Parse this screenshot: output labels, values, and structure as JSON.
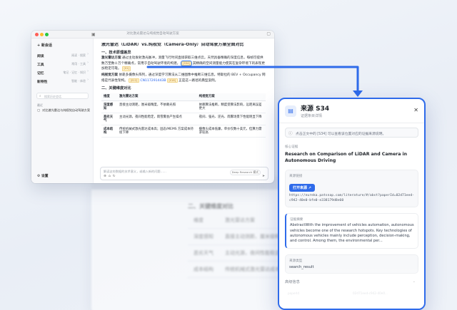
{
  "app": {
    "window_title": "对比激光雷达与纯视觉自动驾驶方案",
    "colors": {
      "accent": "#2f6bea",
      "ref_bg": "#fff3cd",
      "ref_text": "#b7791f"
    }
  },
  "sidebar": {
    "new_chat": "+ 新会话",
    "items": [
      {
        "label": "阅读",
        "sub": "阅读 · 搜索"
      },
      {
        "label": "工具",
        "sub": "常用 · 工具"
      },
      {
        "label": "记忆",
        "sub": "笔记 · 记忆 · 知识"
      },
      {
        "label": "新特性",
        "sub": "智能 · 体验"
      }
    ],
    "search_placeholder": "搜索历史会话",
    "recent_label": "最近",
    "recent_item": "对比激光雷达与纯视觉自动驾驶方案",
    "settings": "⚙ 设置"
  },
  "doc": {
    "title": "激光雷达（LiDAR）vs.纯视觉（Camera-Only）自动驾驶方案全面对比",
    "sec1": "一、技术原理差异",
    "p1_lead": "激光雷达方案",
    "p1_body": "通过主动发射激光脉冲，测量飞行时间直接获取三维点云。天然具备精确的深度信息，每帧可提供数万至数十万个精确点，常用于自动驾驶环境的构建。",
    "ref_main": "[S34]",
    "p1_tail": "其精确的空间测量能力使其在复杂环境下的表现更加稳定可靠。",
    "ref2": "[S1]",
    "p2_lead": "纯视觉方案",
    "p2_body": "依靠多摄像头阵列，通过深度学习算法从二维图像中推断三维信息。特斯拉的 BEV + Occupancy 网络是代表性架构。",
    "ref3": "[S12]",
    "p2_link": "CN117291443B",
    "ref4": "[S18]",
    "p2_tail": "正是这一路径的典型案例。",
    "sec2": "二、关键维度对比",
    "table": {
      "headers": [
        "维度",
        "激光雷达方案",
        "纯视觉方案"
      ],
      "rows": [
        [
          "深度感知",
          "直接主动测距，厘米级精度，不依赖光照",
          "依赖算法推断，精度受算法影响，远距离误差更大"
        ],
        [
          "恶劣天气",
          "主动光源，夜间性能稳定，雨雪雾会产生噪点",
          "夜间、强光、逆光、雨雾场景下性能明显下降"
        ],
        [
          "成本结构",
          "传统机械式激光雷达成本高；固态/MEMS 方案成本持续下降",
          "摄像头成本低廉，单价仅数十美元，但算力需求较高"
        ]
      ]
    },
    "input_placeholder": "解读这些数据的技术意义，或输入新的问题……",
    "mode_label": "Deep Research 模式"
  },
  "ghost": {
    "heading": "二、关键维度对比",
    "rows": [
      [
        "维度",
        "激光雷达方案"
      ],
      [
        "深度感知",
        "直接主动测距、厘米级精度"
      ],
      [
        "恶劣天气",
        "主动光源，夜间性能稳定"
      ],
      [
        "成本结构",
        "传统机械式激光雷达成本高"
      ]
    ]
  },
  "panel": {
    "title": "来源 S34",
    "subtitle": "证据条目详情",
    "close": "✕",
    "note": "点击正文中的 [S34] 可以查看该位置对应的证据来源说明。",
    "core_label": "核心证据",
    "doc_title": "Research on Comparison of LiDAR and Camera in Autonomous Driving",
    "link_label": "来源链接",
    "open_btn": "打开来源 ↗",
    "url": "https://eureka.patsnap.com/literature/#/abst?paperId=02d71eed-c942-40e0-bfe0-e338179d8e60",
    "abstract_label": "证据摘要",
    "abstract": "AbstractWith the improvement of vehicles automation, autonomous vehicles become one of the research hotspots. Key technologies of autonomous vehicles mainly include perception, decision-making, and control. Among them, the environmental per...",
    "source_type_label": "来源类型",
    "source_type": "search_result",
    "advanced_label": "高级信息",
    "faint_left": "paperId",
    "faint_right": "02d71eed-c942-40e0..."
  }
}
